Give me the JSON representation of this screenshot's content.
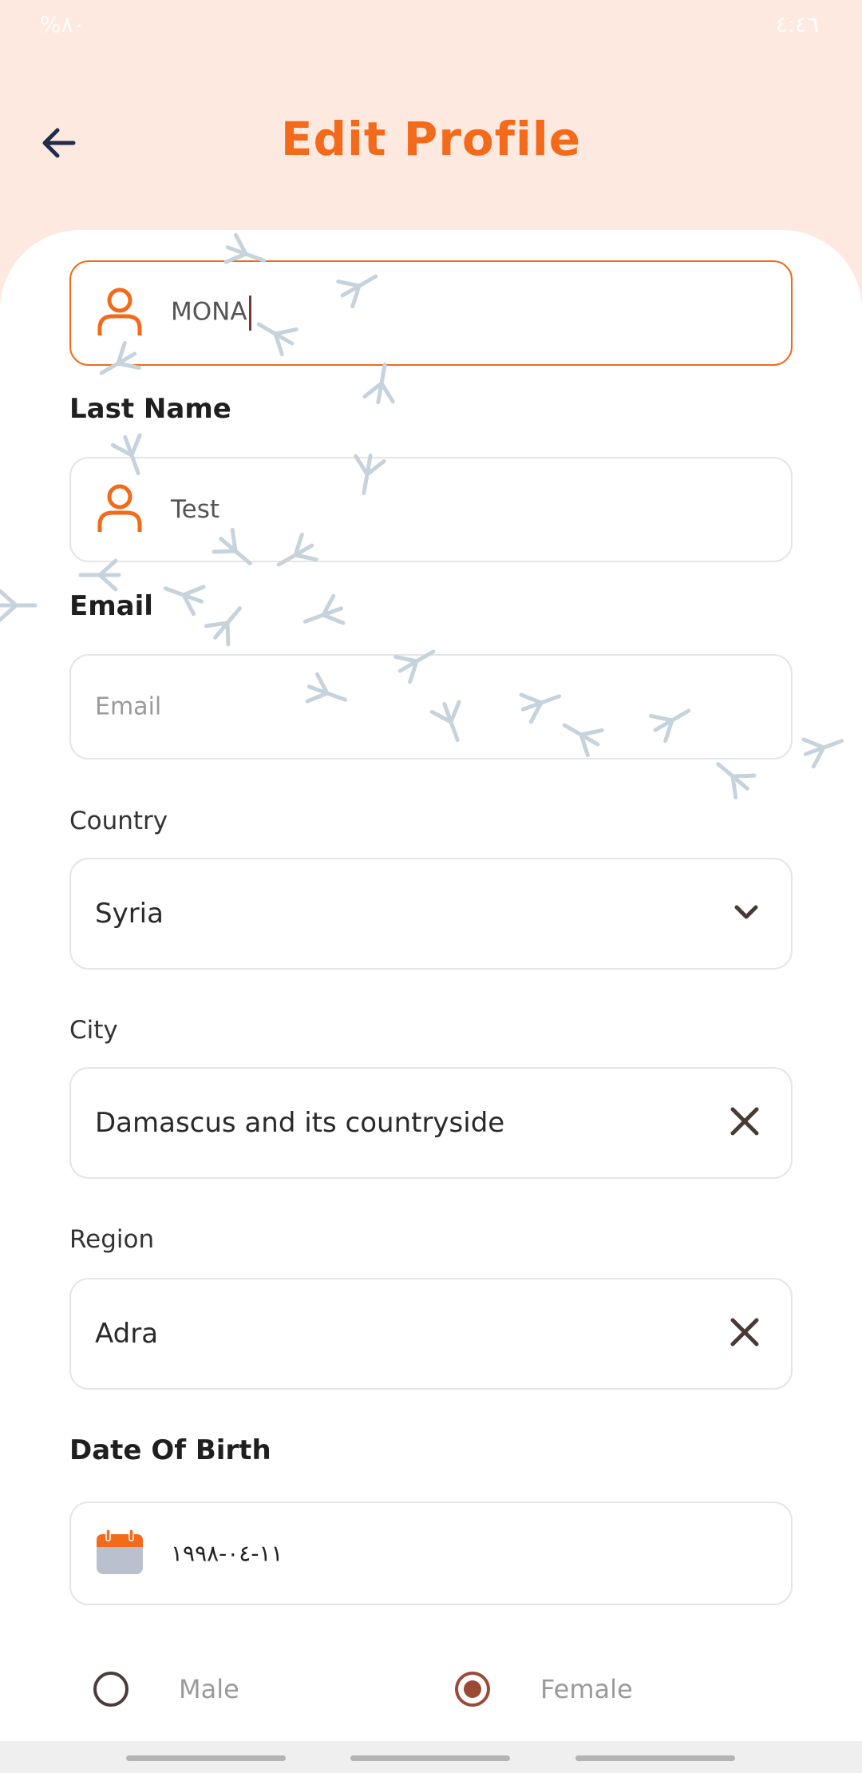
{
  "status_bar": {
    "left": "%٨٠",
    "right": "٤:٤٦"
  },
  "header": {
    "title": "Edit Profile"
  },
  "first_name": {
    "value": "MONA"
  },
  "last_name": {
    "label": "Last Name",
    "value": "Test"
  },
  "email": {
    "label": "Email",
    "placeholder": "Email"
  },
  "country": {
    "label": "Country",
    "value": "Syria"
  },
  "city": {
    "label": "City",
    "value": "Damascus and its countryside"
  },
  "region": {
    "label": "Region",
    "value": "Adra"
  },
  "dob": {
    "label": "Date Of Birth",
    "value": "١١-٠٤-١٩٩٨"
  },
  "gender": {
    "options": [
      "Male",
      "Female"
    ],
    "selected": "Female"
  },
  "colors": {
    "accent": "#f26a1a",
    "background": "#fde9e0",
    "selected_radio": "#9b4a35"
  }
}
